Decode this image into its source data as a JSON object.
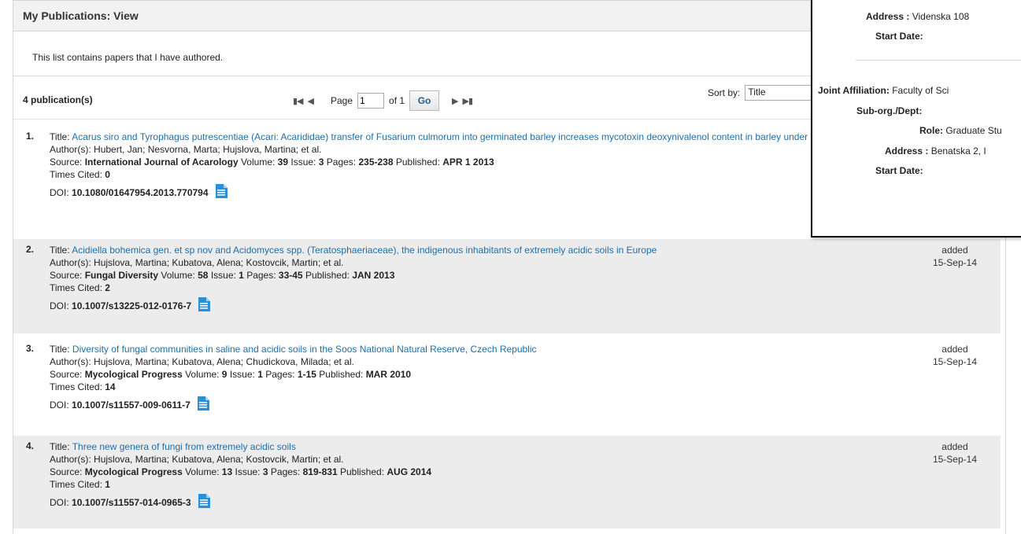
{
  "panel": {
    "title": "My Publications: View",
    "intro": "This list contains papers that I have authored."
  },
  "toolbar": {
    "count": "4 publication(s)",
    "page_label": "Page",
    "page_value": "1",
    "of_label": "of 1",
    "go_label": "Go",
    "sort_label": "Sort by:",
    "sort_value": "Title"
  },
  "publications": [
    {
      "num": "1.",
      "title_label": "Title:",
      "title": "Acarus siro and Tyrophagus putrescentiae (Acari: Acarididae) transfer of Fusarium culmorum into germinated barley increases mycotoxin deoxynivalenol content in barley under laboratory conditions",
      "authors_label": "Author(s):",
      "authors": "Hubert, Jan; Nesvorna, Marta; Hujslova, Martina; et al.",
      "source_label": "Source:",
      "journal": "International Journal of Acarology",
      "volume_label": "Volume:",
      "volume": "39",
      "issue_label": "Issue:",
      "issue": "3",
      "pages_label": "Pages:",
      "pages": "235-238",
      "published_label": "Published:",
      "published": "APR 1 2013",
      "cited_label": "Times Cited:",
      "cited": "0",
      "doi_label": "DOI:",
      "doi": "10.1080/01647954.2013.770794",
      "added": "",
      "added_date": ""
    },
    {
      "num": "2.",
      "title_label": "Title:",
      "title": "Acidiella bohemica gen. et sp nov and Acidomyces spp. (Teratosphaeriaceae), the indigenous inhabitants of extremely acidic soils in Europe",
      "authors_label": "Author(s):",
      "authors": "Hujslova, Martina; Kubatova, Alena; Kostovcik, Martin; et al.",
      "source_label": "Source:",
      "journal": "Fungal Diversity",
      "volume_label": "Volume:",
      "volume": "58",
      "issue_label": "Issue:",
      "issue": "1",
      "pages_label": "Pages:",
      "pages": "33-45",
      "published_label": "Published:",
      "published": "JAN 2013",
      "cited_label": "Times Cited:",
      "cited": "2",
      "doi_label": "DOI:",
      "doi": "10.1007/s13225-012-0176-7",
      "added": "added",
      "added_date": "15-Sep-14"
    },
    {
      "num": "3.",
      "title_label": "Title:",
      "title": "Diversity of fungal communities in saline and acidic soils in the Soos National Natural Reserve, Czech Republic",
      "authors_label": "Author(s):",
      "authors": "Hujslova, Martina; Kubatova, Alena; Chudickova, Milada; et al.",
      "source_label": "Source:",
      "journal": "Mycological Progress",
      "volume_label": "Volume:",
      "volume": "9",
      "issue_label": "Issue:",
      "issue": "1",
      "pages_label": "Pages:",
      "pages": "1-15",
      "published_label": "Published:",
      "published": "MAR 2010",
      "cited_label": "Times Cited:",
      "cited": "14",
      "doi_label": "DOI:",
      "doi": "10.1007/s11557-009-0611-7",
      "added": "added",
      "added_date": "15-Sep-14"
    },
    {
      "num": "4.",
      "title_label": "Title:",
      "title": "Three new genera of fungi from extremely acidic soils",
      "authors_label": "Author(s):",
      "authors": "Hujslova, Martina; Kubatova, Alena; Kostovcik, Martin; et al.",
      "source_label": "Source:",
      "journal": "Mycological Progress",
      "volume_label": "Volume:",
      "volume": "13",
      "issue_label": "Issue:",
      "issue": "3",
      "pages_label": "Pages:",
      "pages": "819-831",
      "published_label": "Published:",
      "published": "AUG 2014",
      "cited_label": "Times Cited:",
      "cited": "1",
      "doi_label": "DOI:",
      "doi": "10.1007/s11557-014-0965-3",
      "added": "added",
      "added_date": "15-Sep-14"
    }
  ],
  "popup": {
    "address_label": "Address :",
    "address_value": "Videnska 108",
    "start_date_label": "Start Date:",
    "joint_label": "Joint Affiliation:",
    "joint_value": "Faculty of Sci",
    "suborg_label": "Sub-org./Dept:",
    "role_label": "Role:",
    "role_value": "Graduate Stu",
    "address2_label": "Address :",
    "address2_value": "Benatska 2, I",
    "start_date2_label": "Start Date:"
  },
  "colors": {
    "link": "#1f6ea8",
    "row_shade": "#ececec",
    "header_bg": "#f2f2f2",
    "doc_icon": "#2a8fd6"
  }
}
